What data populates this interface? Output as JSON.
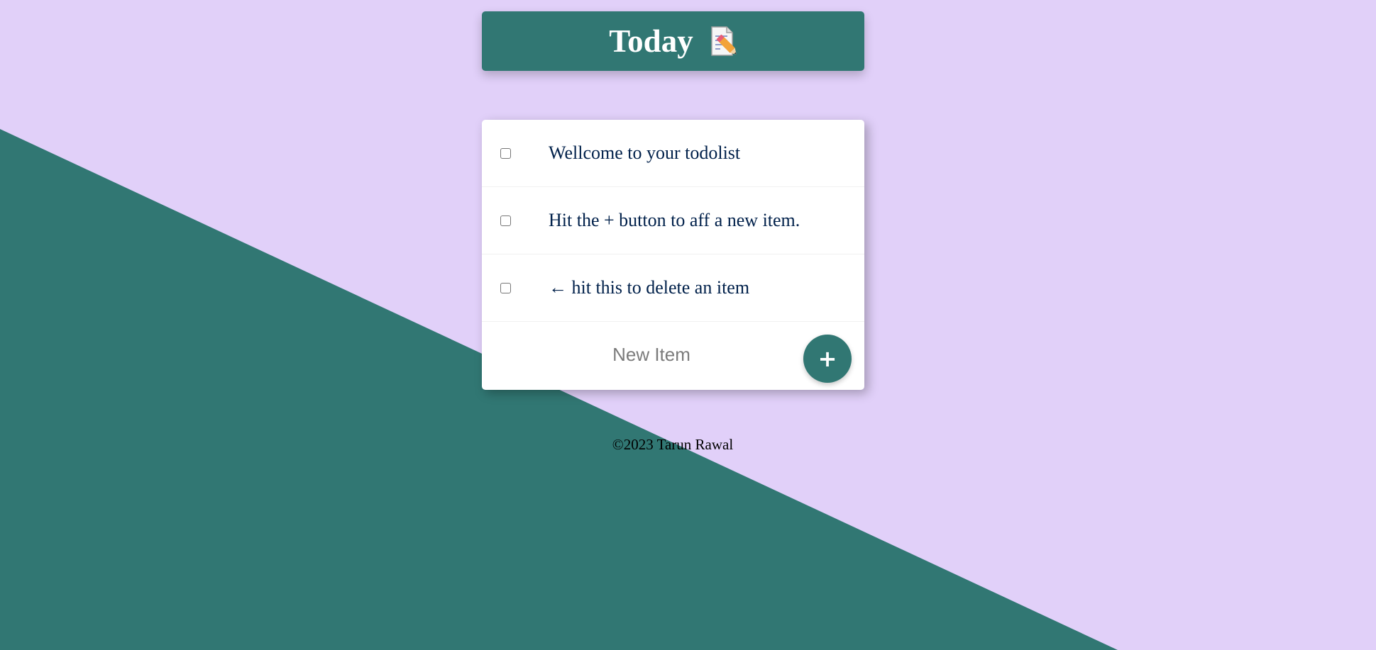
{
  "colors": {
    "background": "#E1D0F9",
    "accent": "#317773",
    "card": "#FFFFFF",
    "item_text": "#00204A"
  },
  "header": {
    "title": "Today",
    "icon": "memo-icon"
  },
  "todo": {
    "items": [
      {
        "label": "Wellcome to your todolist",
        "checked": false
      },
      {
        "label": "Hit the + button to aff a new item.",
        "checked": false
      },
      {
        "label": "← hit this to delete an item",
        "checked": false
      }
    ],
    "new_item": {
      "placeholder": "New Item",
      "value": ""
    },
    "add_button_label": "+"
  },
  "footer": {
    "text": "©2023 Tarun Rawal"
  }
}
